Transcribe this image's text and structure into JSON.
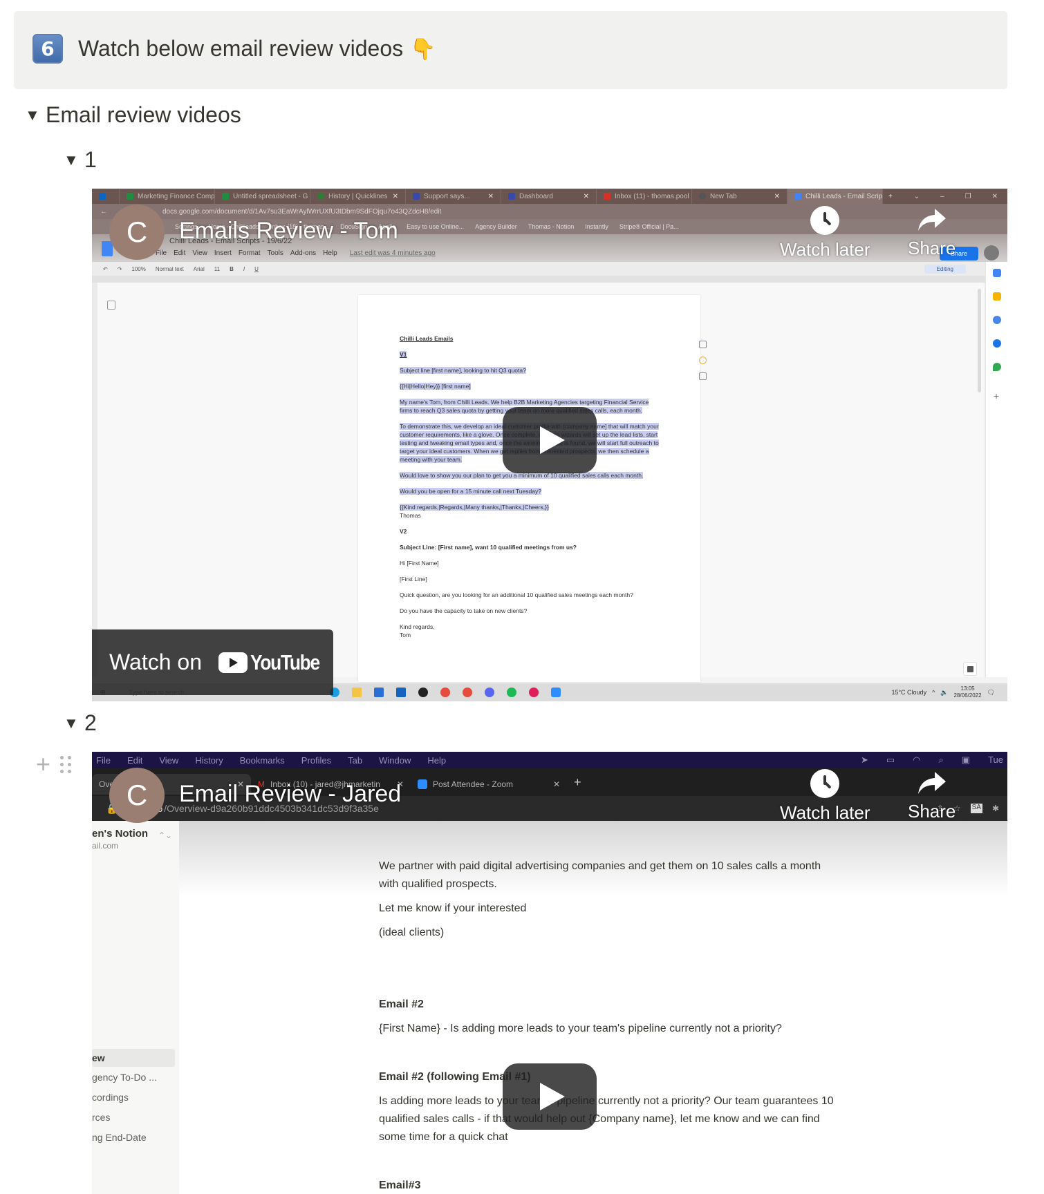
{
  "callout": {
    "number": "6",
    "text": "Watch below email review videos",
    "emoji": "👇"
  },
  "toggles": {
    "top": {
      "label": "Email review videos",
      "expanded": true
    },
    "item1": {
      "label": "1",
      "expanded": true
    },
    "item2": {
      "label": "2",
      "expanded": true
    }
  },
  "youtube": {
    "channel_initial": "C",
    "watch_later": "Watch later",
    "share": "Share",
    "watch_on": "Watch on",
    "youtube_wordmark": "YouTube",
    "avatar_color": "#9b7e72"
  },
  "video1": {
    "title": "Emails Review - Tom",
    "browser_tabs": [
      {
        "label": "Marketing Finance Comp",
        "favicon": "#1e8e3e"
      },
      {
        "label": "Untitled spreadsheet - G",
        "favicon": "#1e8e3e"
      },
      {
        "label": "History | Quicklines",
        "favicon": "#2e7d32"
      },
      {
        "label": "Support says...",
        "favicon": "#3949ab"
      },
      {
        "label": "Dashboard",
        "favicon": "#3949ab"
      },
      {
        "label": "Inbox (11) - thomas.pool",
        "favicon": "#d93025"
      },
      {
        "label": "New Tab",
        "favicon": "#555555"
      },
      {
        "label": "Chilli Leads - Email Script",
        "favicon": "#4285f4",
        "active": true
      }
    ],
    "url": "docs.google.com/document/d/1Av7su3EaWrAylWrrUXfU3tDbm9SdFOjqu7o43QZdcH8/edit",
    "bookmarks": [
      "Settings",
      "Home - Chillileads",
      "Inbox (18) - thomas...",
      "DocuSign",
      "Apollo",
      "Easy to use Online...",
      "Agency Builder",
      "Thomas - Notion",
      "Instantly",
      "Stripe® Official | Pa..."
    ],
    "doc_title": "Chilli Leads - Email Scripts - 19/6/22",
    "doc_menus": [
      "File",
      "Edit",
      "View",
      "Insert",
      "Format",
      "Tools",
      "Add-ons",
      "Help"
    ],
    "last_edit": "Last edit was 4 minutes ago",
    "share_button": "Share",
    "toolbar": {
      "zoom": "100%",
      "style": "Normal text",
      "font": "Arial",
      "size": "11",
      "mode": "Editing"
    },
    "doc_lines": {
      "heading": "Chilli Leads Emails",
      "v1": "V1",
      "v1_subject": "Subject line [first name], looking to hit Q3 quota?",
      "v1_greeting": "{{Hi|Hello|Hey}} [first name]",
      "v1_p1": "My name's Tom, from Chilli Leads. We help B2B Marketing Agencies targeting Financial Service firms to reach Q3 sales quota by getting your team on more qualified sales calls, each month.",
      "v1_p2": "To demonstrate this, we develop an ideal customer profile with [company name] that will match your customer requirements, like a glove. Once complete, our tech wizards will set up the lead lists, start testing and tweaking email types and, once the winning combo is found, we will start full outreach to target your ideal customers. When we get replies from interested prospects, we then schedule a meeting with your team.",
      "v1_p3": "Would love to show you our plan to get you a minimum of 10 qualified sales calls each month.",
      "v1_p4": "Would you be open for a 15 minute call next Tuesday?",
      "v1_signoff": "{{Kind regards,|Regards,|Many thanks,|Thanks,|Cheers,}}",
      "v1_name": "Thomas",
      "v2": "V2",
      "v2_subject": "Subject Line: [First name], want 10 qualified meetings from us?",
      "v2_greeting": "Hi [First Name]",
      "v2_firstline": "[First Line]",
      "v2_p1": "Quick question, are you looking for an additional 10 qualified sales meetings each month?",
      "v2_p2": "Do you have the capacity to take on new clients?",
      "v2_signoff": "Kind regards,",
      "v2_name": "Tom"
    },
    "taskbar": {
      "search_placeholder": "Type here to search",
      "weather": "15°C  Cloudy",
      "time": "13:05",
      "date": "28/06/2022"
    }
  },
  "video2": {
    "title": "Email Review - Jared",
    "mac_menu": [
      "File",
      "Edit",
      "View",
      "History",
      "Bookmarks",
      "Profiles",
      "Tab",
      "Window",
      "Help"
    ],
    "mac_menu_right": "Tue",
    "browser_tabs": [
      {
        "label": "Overview",
        "active": true
      },
      {
        "label": "Inbox (10) - jared@jhmarketin"
      },
      {
        "label": "Post Attendee - Zoom"
      }
    ],
    "url_domain": "notion.so",
    "url_path": "/Overview-d9a260b91ddc4503b341dc53d9f3a35e",
    "ext_badge": "SA",
    "workspace_name": "en's Notion",
    "workspace_email": "ail.com",
    "sidebar_items": [
      {
        "label": "ew",
        "active": true
      },
      {
        "label": "gency To-Do ..."
      },
      {
        "label": "cordings"
      },
      {
        "label": "rces"
      },
      {
        "label": "ng End-Date"
      }
    ],
    "content": {
      "p1_line1": "We partner with paid digital advertising companies and get them on 10 sales calls a month",
      "p1_line2": "with qualified prospects.",
      "p2": "Let me know if your interested",
      "p3": "(ideal clients)",
      "h_email2": "Email #2",
      "email2_body": "{First Name} - Is adding more leads to your team's pipeline currently not a priority?",
      "h_email2_follow": "Email #2 (following Email #1)",
      "follow_line1": "Is adding more leads to your team's pipeline currently not a priority? Our team guarantees 10",
      "follow_line2": "qualified sales calls - if that would help out {Company name}, let me know and we can find",
      "follow_line3": "some time for a quick chat",
      "h_email3": "Email#3"
    }
  }
}
